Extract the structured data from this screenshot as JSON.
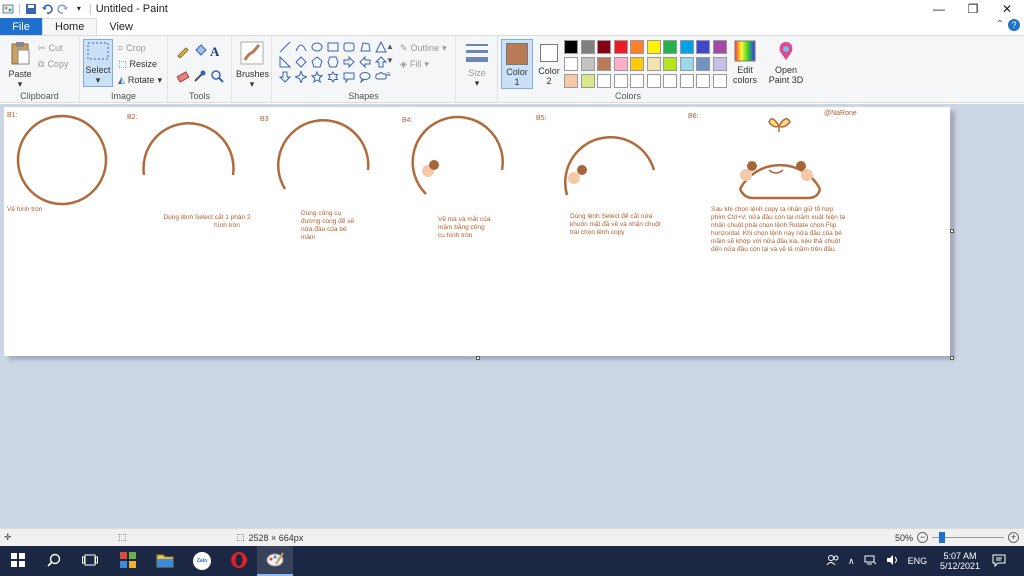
{
  "window": {
    "title": "Untitled - Paint"
  },
  "tabs": {
    "file": "File",
    "home": "Home",
    "view": "View"
  },
  "ribbon": {
    "clipboard": {
      "paste": "Paste",
      "cut": "Cut",
      "copy": "Copy",
      "label": "Clipboard"
    },
    "image": {
      "select": "Select",
      "crop": "Crop",
      "resize": "Resize",
      "rotate": "Rotate",
      "label": "Image"
    },
    "tools": {
      "label": "Tools"
    },
    "brushes": {
      "label": "Brushes"
    },
    "shapes": {
      "outline": "Outline",
      "fill": "Fill",
      "label": "Shapes"
    },
    "size": {
      "label": "Size"
    },
    "color1": {
      "label": "Color",
      "num": "1",
      "value": "#b97a57"
    },
    "color2": {
      "label": "Color",
      "num": "2",
      "value": "#ffffff"
    },
    "palette": [
      "#000000",
      "#7f7f7f",
      "#880015",
      "#ed1c24",
      "#ff7f27",
      "#fff200",
      "#22b14c",
      "#00a2e8",
      "#3f48cc",
      "#a349a4",
      "#ffffff",
      "#c3c3c3",
      "#b97a57",
      "#ffaec9",
      "#ffc90e",
      "#efe4b0",
      "#b5e61d",
      "#99d9ea",
      "#7092be",
      "#c8bfe7",
      "#f5c8a8",
      "#d9e88b",
      "#ffffff",
      "#ffffff",
      "#ffffff",
      "#ffffff",
      "#ffffff",
      "#ffffff",
      "#ffffff",
      "#ffffff"
    ],
    "edit_colors": {
      "line1": "Edit",
      "line2": "colors"
    },
    "paint3d": {
      "line1": "Open",
      "line2": "Paint 3D"
    },
    "colors_label": "Colors"
  },
  "canvas": {
    "brown": "#b06a3c",
    "credit": "@NaRone",
    "steps": {
      "b1": "B1:",
      "b2": "B2:",
      "b3": "B3",
      "b4": "B4:",
      "b5": "B5:",
      "b6": "B6:"
    },
    "notes": {
      "n1": "Vẽ hình tròn",
      "n2a": "Dùng lệnh Select cắt 1 phần 2",
      "n2b": "hình tròn",
      "n3a": "Dùng công cụ",
      "n3b": "đường cong để vẽ",
      "n3c": "nửa đầu của bé",
      "n3d": "mầm",
      "n4a": "Vẽ má và mắt của",
      "n4b": "mầm bằng công",
      "n4c": "cụ hình tròn",
      "n5a": "Dùng lệnh Select để cắt nửa",
      "n5b": "khuôn mặt đã vẽ và nhấn chuột",
      "n5c": "trái chọn lệnh copy",
      "n6a": "Sau khi chọn lệnh copy ta nhấn giữ tổ hợp",
      "n6b": "phím Ctrl+V, nửa đầu còn lại mầm xuất hiện ta",
      "n6c": "nhấn chuột phải chọn lệnh Rotate chọn Flip",
      "n6d": "horizontal. Khi chọn lệnh này nửa đầu của bé",
      "n6e": "mầm sẽ khớp với nửa đầu kia, kéo thả chuột",
      "n6f": "đến nửa đầu còn lại và vẽ lá mầm trên đầu."
    }
  },
  "status": {
    "dimensions": "2528 × 664px",
    "zoom": "50%",
    "zoom_fraction": 0.5
  },
  "taskbar": {
    "lang": "ENG",
    "time": "5:07 AM",
    "date": "5/12/2021",
    "zalo": "Zalo"
  }
}
